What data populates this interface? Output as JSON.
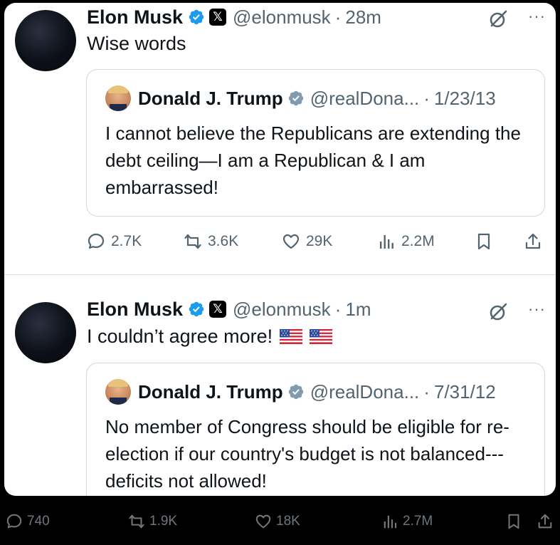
{
  "tweets": [
    {
      "author": {
        "name": "Elon Musk",
        "handle": "@elonmusk",
        "affiliate_badge": "𝕏"
      },
      "time": "28m",
      "text": "Wise words",
      "quote": {
        "author": {
          "name": "Donald J. Trump",
          "handle": "@realDona..."
        },
        "date": "1/23/13",
        "text": "I cannot believe the Republicans are extending the debt ceiling—I am a Republican & I am embarrassed!"
      },
      "stats": {
        "replies": "2.7K",
        "reposts": "3.6K",
        "likes": "29K",
        "views": "2.2M"
      }
    },
    {
      "author": {
        "name": "Elon Musk",
        "handle": "@elonmusk",
        "affiliate_badge": "𝕏"
      },
      "time": "1m",
      "text": "I couldn’t agree more!",
      "quote": {
        "author": {
          "name": "Donald J. Trump",
          "handle": "@realDona..."
        },
        "date": "7/31/12",
        "text": "No member of Congress should be eligible for re-election if our country's budget is not balanced---deficits not allowed!"
      },
      "stats": {
        "replies": "740",
        "reposts": "1.9K",
        "likes": "18K",
        "views": "2.7M"
      }
    }
  ],
  "ui": {
    "more_glyph": "···",
    "dot_separator": "·"
  },
  "icons": [
    "verified-badge-icon",
    "x-affiliate-icon",
    "grok-icon",
    "more-icon",
    "reply-icon",
    "repost-icon",
    "like-icon",
    "views-icon",
    "bookmark-icon",
    "share-icon",
    "us-flag-icon"
  ],
  "colors": {
    "background": "#000000",
    "card": "#ffffff",
    "text": "#0f1419",
    "secondary": "#536471",
    "verified": "#1d9bf0",
    "border": "#cfd9de"
  }
}
